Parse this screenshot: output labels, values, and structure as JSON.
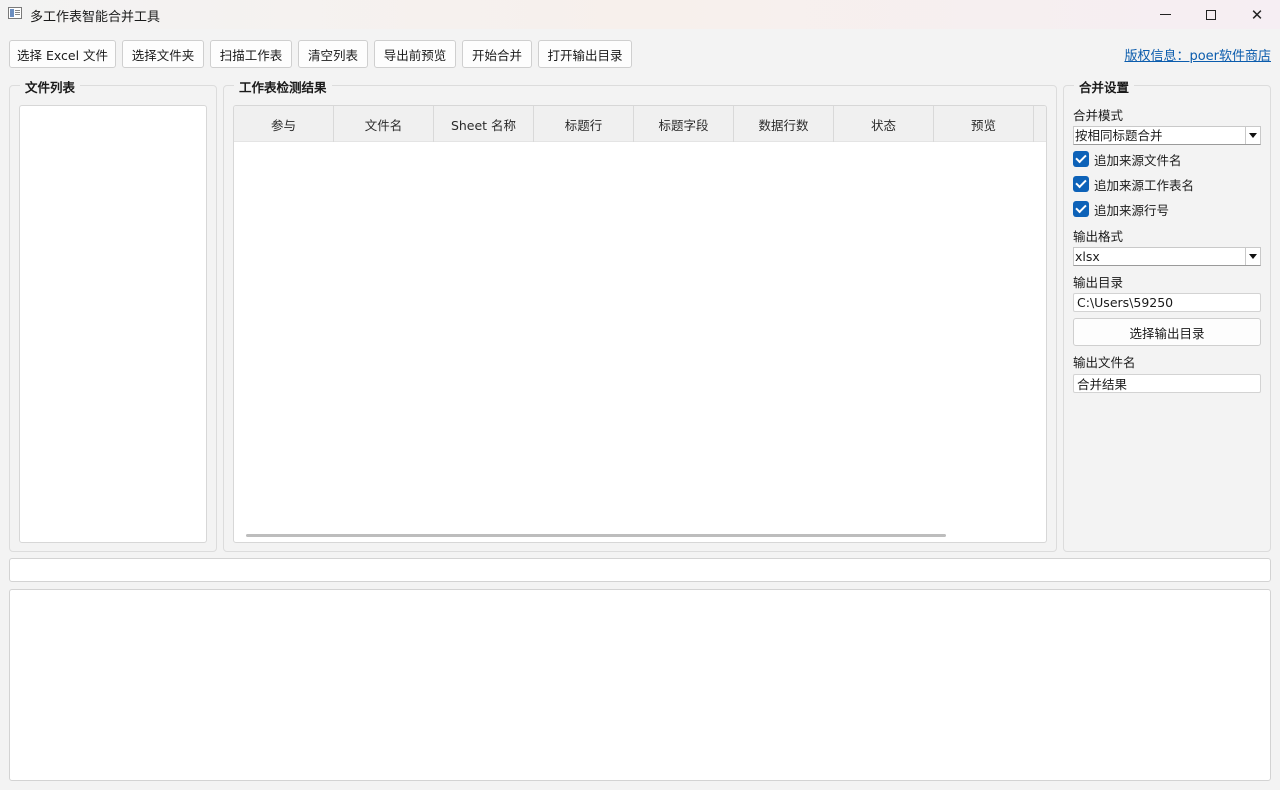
{
  "window": {
    "title": "多工作表智能合并工具"
  },
  "toolbar": {
    "buttons": [
      "选择 Excel 文件",
      "选择文件夹",
      "扫描工作表",
      "清空列表",
      "导出前预览",
      "开始合并",
      "打开输出目录"
    ],
    "copyright": "版权信息：poer软件商店"
  },
  "file_list": {
    "title": "文件列表"
  },
  "results": {
    "title": "工作表检测结果",
    "columns": [
      "参与",
      "文件名",
      "Sheet 名称",
      "标题行",
      "标题字段",
      "数据行数",
      "状态",
      "预览"
    ]
  },
  "settings": {
    "title": "合并设置",
    "merge_mode_label": "合并模式",
    "merge_mode_value": "按相同标题合并",
    "checkboxes": [
      {
        "label": "追加来源文件名",
        "checked": true
      },
      {
        "label": "追加来源工作表名",
        "checked": true
      },
      {
        "label": "追加来源行号",
        "checked": true
      }
    ],
    "output_format_label": "输出格式",
    "output_format_value": "xlsx",
    "output_dir_label": "输出目录",
    "output_dir_value": "C:\\Users\\59250",
    "choose_dir_button": "选择输出目录",
    "output_name_label": "输出文件名",
    "output_name_value": "合并结果"
  },
  "colors": {
    "accent": "#0d62b8",
    "link": "#0b5cad"
  }
}
